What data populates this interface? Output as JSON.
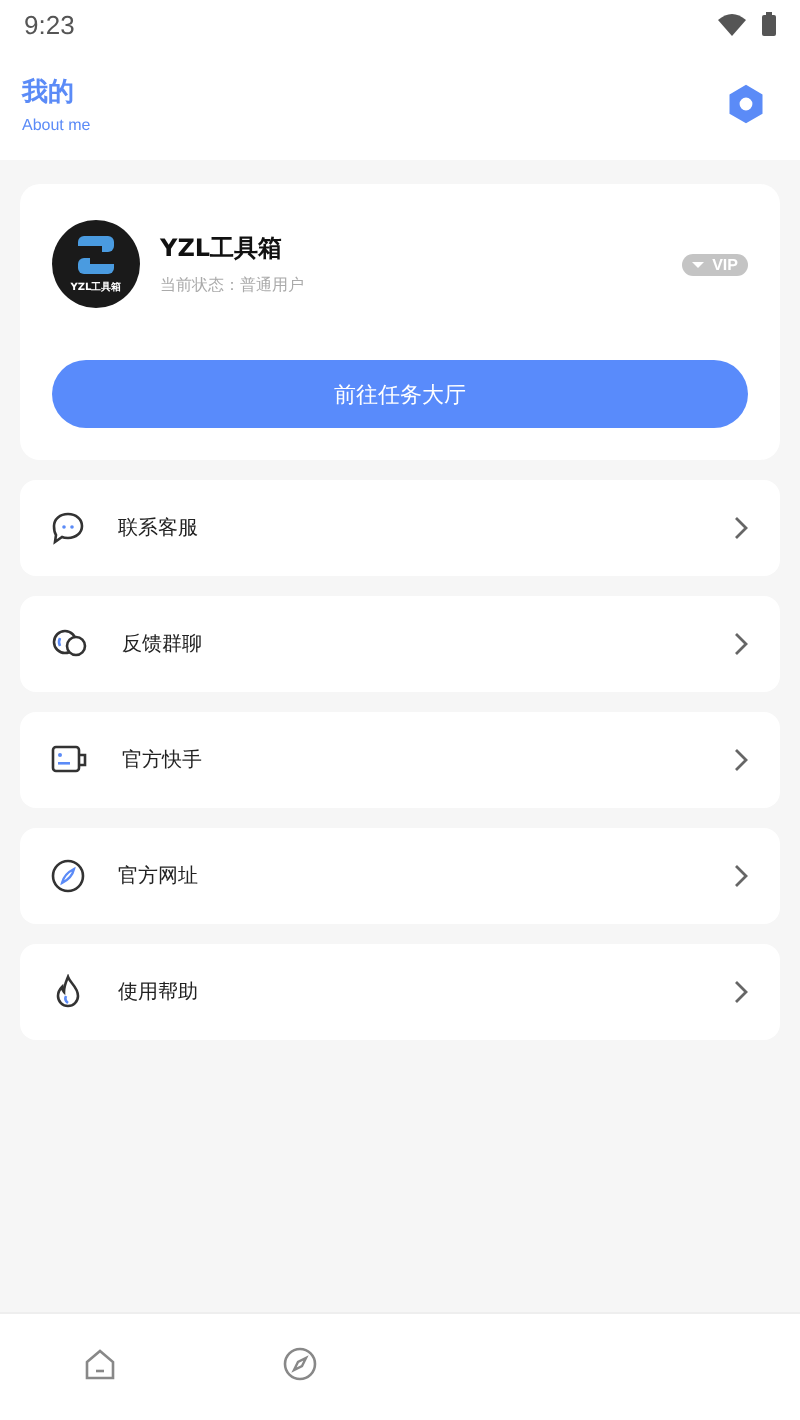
{
  "status_bar": {
    "time": "9:23"
  },
  "header": {
    "title": "我的",
    "subtitle": "About me"
  },
  "profile": {
    "avatar_label": "YZL工具箱",
    "name": "YZL工具箱",
    "status": "当前状态：普通用户",
    "badge": "VIP",
    "button": "前往任务大厅"
  },
  "menu": [
    {
      "kind": "chat",
      "label": "联系客服"
    },
    {
      "kind": "group",
      "label": "反馈群聊"
    },
    {
      "kind": "video",
      "label": "官方快手"
    },
    {
      "kind": "compass",
      "label": "官方网址"
    },
    {
      "kind": "flame",
      "label": "使用帮助"
    }
  ],
  "nav": [
    {
      "kind": "home"
    },
    {
      "kind": "compass"
    }
  ]
}
